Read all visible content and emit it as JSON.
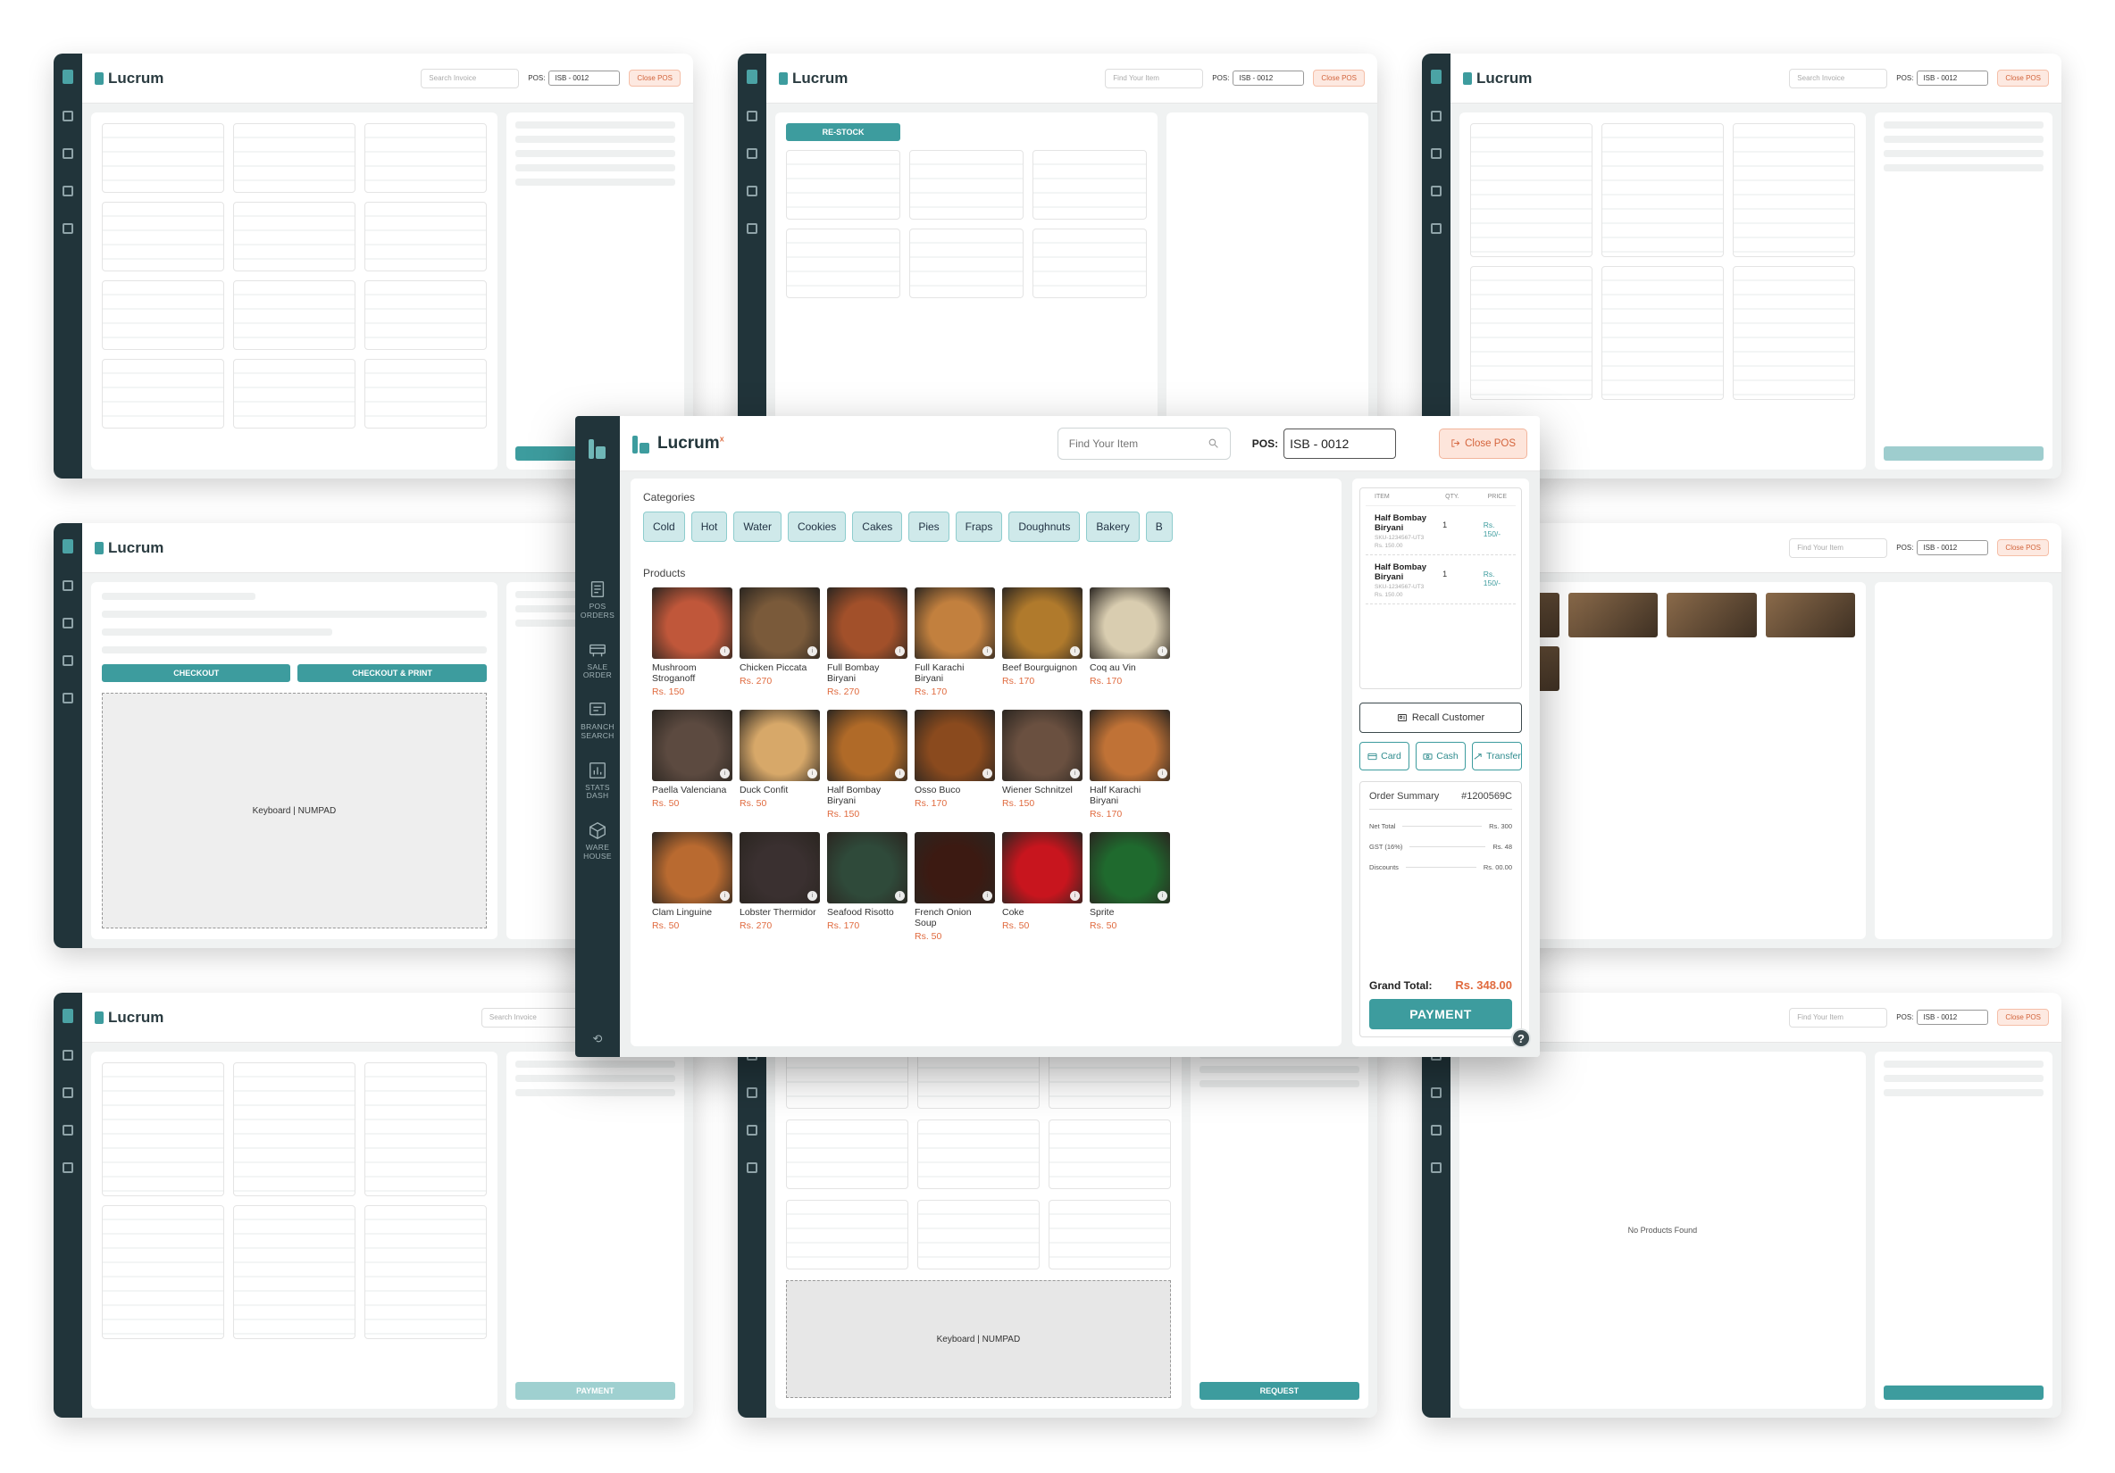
{
  "brand": {
    "name": "Lucrum",
    "mark": "x"
  },
  "rail": {
    "items": [
      {
        "label": "POS ORDERS",
        "icon": "pos-orders-icon"
      },
      {
        "label": "SALE ORDER",
        "icon": "sale-order-icon"
      },
      {
        "label": "BRANCH SEARCH",
        "icon": "branch-search-icon"
      },
      {
        "label": "STATS DASH",
        "icon": "stats-icon"
      },
      {
        "label": "WARE HOUSE",
        "icon": "warehouse-icon"
      }
    ]
  },
  "header": {
    "search_placeholder": "Find Your Item",
    "pos_label": "POS:",
    "pos_value": "ISB - 0012",
    "close_label": "Close POS"
  },
  "categories": {
    "title": "Categories",
    "items": [
      "Cold",
      "Hot",
      "Water",
      "Cookies",
      "Cakes",
      "Pies",
      "Fraps",
      "Doughnuts",
      "Bakery",
      "B"
    ]
  },
  "products": {
    "title": "Products",
    "items": [
      {
        "name": "Mushroom Stroganoff",
        "price": "Rs. 150",
        "color": "#c0573a"
      },
      {
        "name": "Chicken Piccata",
        "price": "Rs. 270",
        "color": "#7a5a3a"
      },
      {
        "name": "Full Bombay Biryani",
        "price": "Rs. 270",
        "color": "#a2502a"
      },
      {
        "name": "Full Karachi Biryani",
        "price": "Rs. 170",
        "color": "#c2803e"
      },
      {
        "name": "Beef Bourguignon",
        "price": "Rs. 170",
        "color": "#b07a2c"
      },
      {
        "name": "Coq au Vin",
        "price": "Rs. 170",
        "color": "#d9cdb0"
      },
      {
        "name": "Paella Valenciana",
        "price": "Rs. 50",
        "color": "#5c4a40"
      },
      {
        "name": "Duck Confit",
        "price": "Rs. 50",
        "color": "#d7a869"
      },
      {
        "name": "Half Bombay Biryani",
        "price": "Rs. 150",
        "color": "#b06a28"
      },
      {
        "name": "Osso Buco",
        "price": "Rs. 170",
        "color": "#8a4a1e"
      },
      {
        "name": "Wiener Schnitzel",
        "price": "Rs. 150",
        "color": "#6a5040"
      },
      {
        "name": "Half Karachi Biryani",
        "price": "Rs. 170",
        "color": "#c07236"
      },
      {
        "name": "Clam Linguine",
        "price": "Rs. 50",
        "color": "#b96a30"
      },
      {
        "name": "Lobster Thermidor",
        "price": "Rs. 270",
        "color": "#3a3030"
      },
      {
        "name": "Seafood Risotto",
        "price": "Rs. 170",
        "color": "#2f4a3a"
      },
      {
        "name": "French Onion Soup",
        "price": "Rs. 50",
        "color": "#3c1a12"
      },
      {
        "name": "Coke",
        "price": "Rs. 50",
        "color": "#c8151e"
      },
      {
        "name": "Sprite",
        "price": "Rs. 50",
        "color": "#1f6a2e"
      }
    ]
  },
  "cart": {
    "headers": [
      "ITEM",
      "QTY.",
      "PRICE"
    ],
    "rows": [
      {
        "name": "Half Bombay Biryani",
        "sku": "SKU-1234567-UT3",
        "sub": "Rs. 150.00",
        "qty": "1",
        "price": "Rs. 150/-"
      },
      {
        "name": "Half Bombay Biryani",
        "sku": "SKU-1234567-UT3",
        "sub": "Rs. 150.00",
        "qty": "1",
        "price": "Rs. 150/-"
      }
    ]
  },
  "actions": {
    "recall": "Recall Customer",
    "card": "Card",
    "cash": "Cash",
    "transfer": "Transfer"
  },
  "summary": {
    "title": "Order Summary",
    "order_id": "#1200569C",
    "net_total_label": "Net Total",
    "net_total": "Rs. 300",
    "gst_label": "GST (16%)",
    "gst": "Rs. 48",
    "discounts_label": "Discounts",
    "discounts": "Rs. 00.00",
    "grand_label": "Grand Total:",
    "grand_value": "Rs. 348.00",
    "payment_label": "PAYMENT"
  },
  "background_screens": {
    "search_invoice": "Search Invoice",
    "find_item": "Find Your Item",
    "pos": "ISB - 0012",
    "close": "Close POS",
    "restock": "RE-STOCK",
    "checkout": "CHECKOUT",
    "checkout_print": "CHECKOUT & PRINT",
    "keyboard": "Keyboard | NUMPAD",
    "request": "REQUEST",
    "payment": "PAYMENT",
    "no_products": "No Products Found"
  }
}
